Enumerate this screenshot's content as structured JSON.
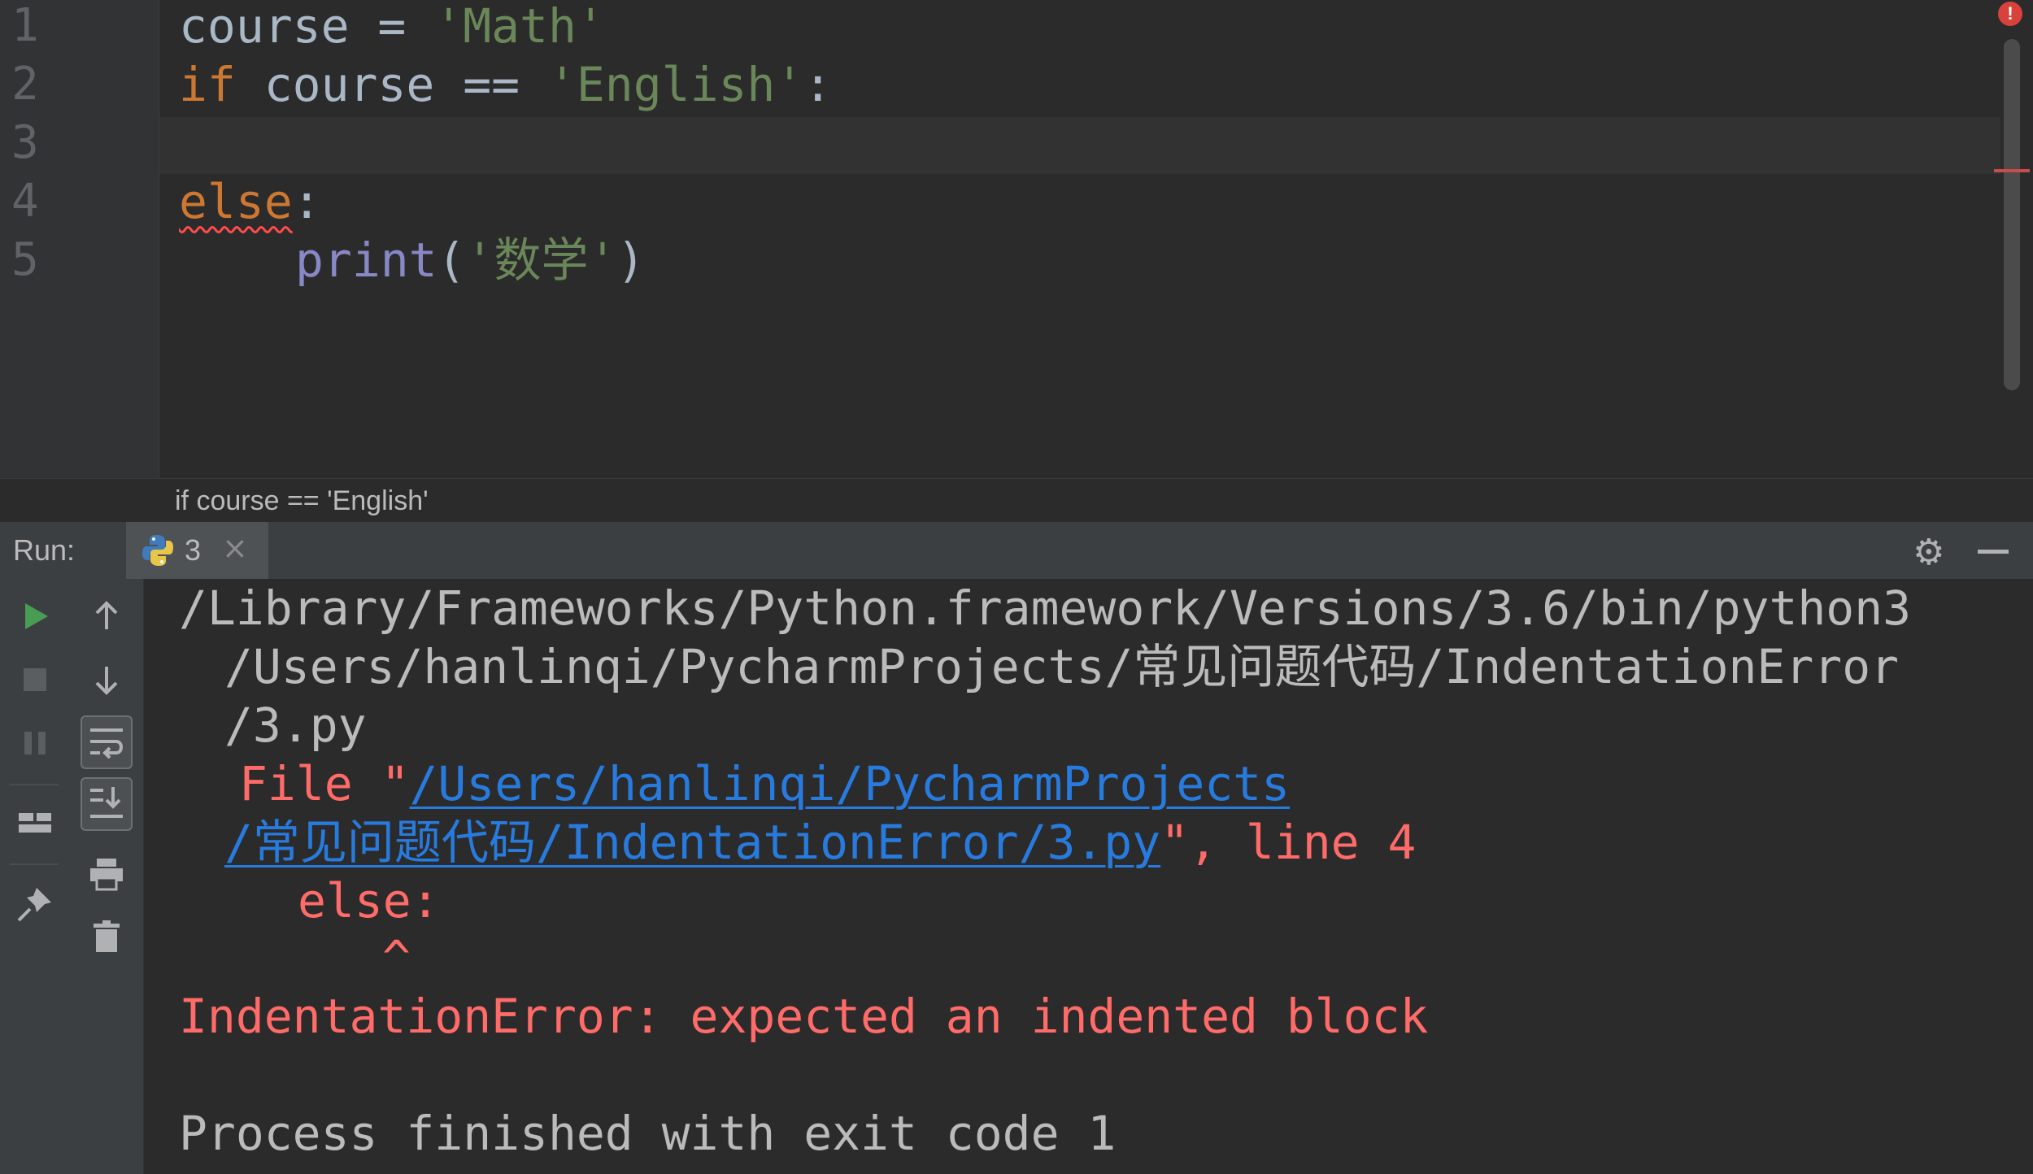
{
  "editor": {
    "line_numbers": [
      "1",
      "2",
      "3",
      "4",
      "5"
    ],
    "line1": {
      "var": "course",
      "op": " = ",
      "str": "'Math'"
    },
    "line2": {
      "kw": "if",
      "var": " course ",
      "op": "== ",
      "str": "'English'",
      "colon": ":"
    },
    "line4": {
      "kw": "else",
      "colon": ":"
    },
    "line5": {
      "fn": "print",
      "open": "(",
      "str": "'数学'",
      "close": ")"
    }
  },
  "breadcrumb": {
    "text": "if course == 'English'"
  },
  "run_panel": {
    "label": "Run:",
    "tab_label": "3",
    "icons": {
      "tab_close": "close-icon",
      "settings": "gear-icon",
      "minimize": "minimize-icon",
      "python": "python-icon"
    }
  },
  "toolbar": {
    "left": [
      "play-icon",
      "stop-icon",
      "pause-icon",
      "layout-icon",
      "pin-icon"
    ],
    "right": [
      "arrow-up-icon",
      "arrow-down-icon",
      "soft-wrap-icon",
      "scroll-to-end-icon",
      "print-icon",
      "trash-icon"
    ]
  },
  "console": {
    "command_1": "/Library/Frameworks/Python.framework/Versions/3.6/bin/python3",
    "command_2": "/Users/hanlinqi/PycharmProjects/常见问题代码/IndentationError",
    "command_3": "/3.py",
    "file_prefix": "File \"",
    "file_link_1": "/Users/hanlinqi/PycharmProjects",
    "file_link_2": "/常见问题代码/IndentationError/3.py",
    "file_suffix": "\", line 4",
    "code_line": "else:",
    "caret": "^",
    "error_message": "IndentationError: expected an indented block",
    "exit_message": "Process finished with exit code 1"
  },
  "colors": {
    "background": "#2b2b2b",
    "keyword": "#cc7832",
    "string": "#6a8759",
    "builtin": "#8888c6",
    "error": "#ff6b68",
    "link": "#287bde",
    "run_green": "#499c54"
  }
}
